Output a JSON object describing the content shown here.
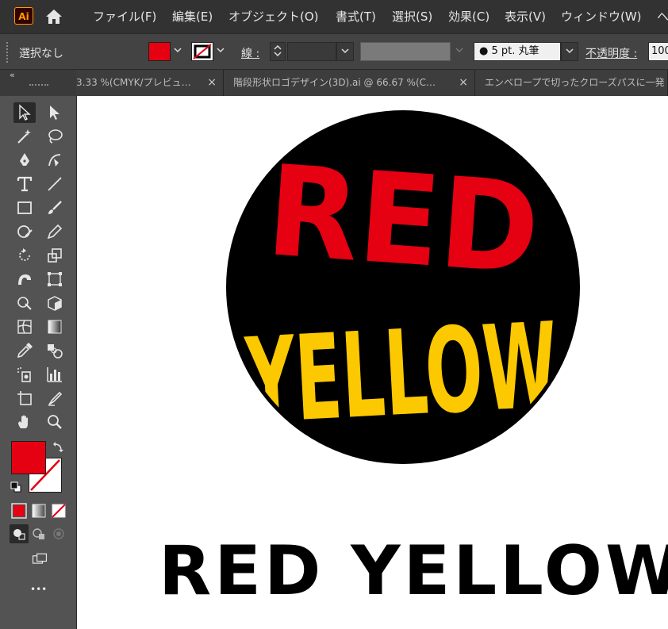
{
  "app": {
    "logo": "Ai"
  },
  "menu": [
    "ファイル(F)",
    "編集(E)",
    "オブジェクト(O)",
    "書式(T)",
    "選択(S)",
    "効果(C)",
    "表示(V)",
    "ウィンドウ(W)",
    "ヘ"
  ],
  "control": {
    "selection_label": "選択なし",
    "stroke_label": "線 :",
    "brush_value": "5 pt. 丸筆",
    "opacity_label": "不透明度 :",
    "opacity_value": "100",
    "fill_color": "#e50012"
  },
  "tabs": [
    {
      "title": "3.33 %(CMYK/プレビュ…",
      "close": "×"
    },
    {
      "title": "階段形状ロゴデザイン(3D).ai @ 66.67 %(C…",
      "close": "×"
    },
    {
      "title": "エンベロープで切ったクローズパスに一発",
      "close": ""
    }
  ],
  "toolbar": {
    "collapse": "«",
    "more": "•••"
  },
  "artwork": {
    "circle_color": "#000000",
    "red_word": "RED",
    "red_color": "#e50012",
    "yellow_word": "YELLOW",
    "yellow_color": "#fcc800",
    "caption": "RED YELLOW"
  }
}
